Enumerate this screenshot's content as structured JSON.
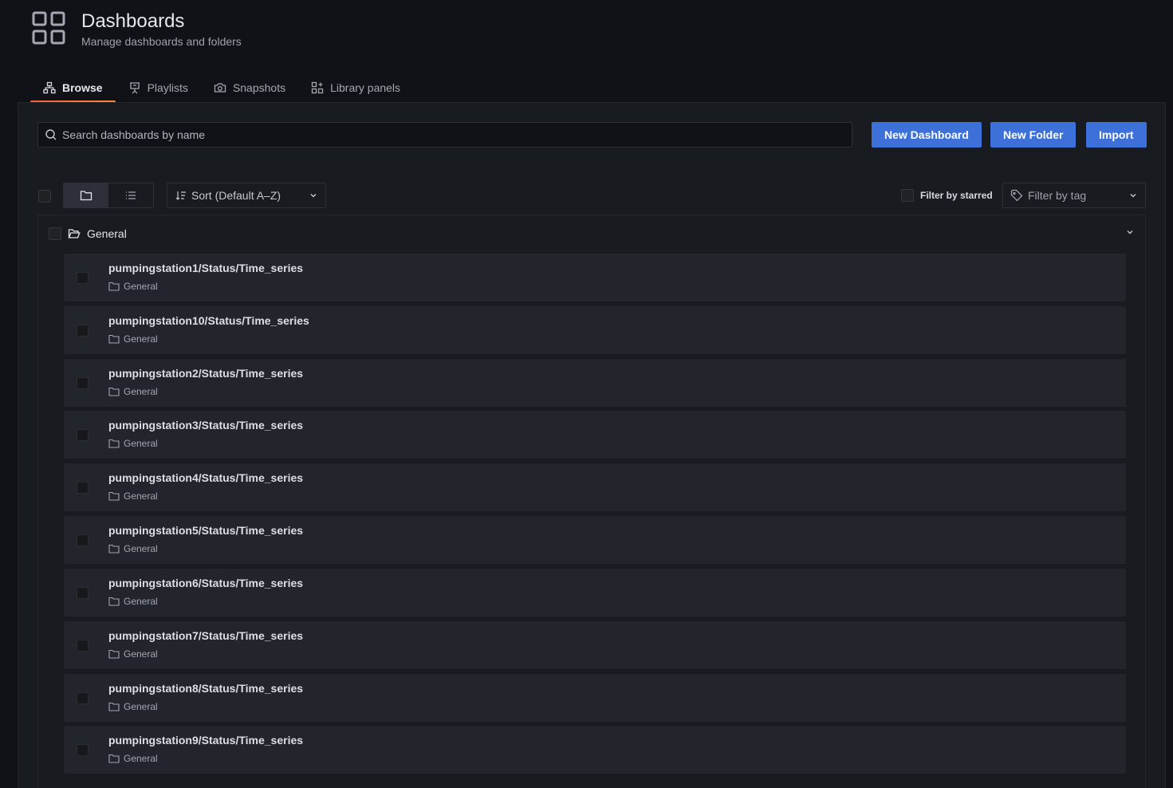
{
  "header": {
    "title": "Dashboards",
    "subtitle": "Manage dashboards and folders"
  },
  "tabs": [
    {
      "label": "Browse",
      "icon": "sitemap-icon",
      "active": true
    },
    {
      "label": "Playlists",
      "icon": "presentation-icon",
      "active": false
    },
    {
      "label": "Snapshots",
      "icon": "camera-icon",
      "active": false
    },
    {
      "label": "Library panels",
      "icon": "apps-icon",
      "active": false
    }
  ],
  "search": {
    "placeholder": "Search dashboards by name"
  },
  "actions": {
    "new_dashboard": "New Dashboard",
    "new_folder": "New Folder",
    "import": "Import"
  },
  "toolbar": {
    "sort_label": "Sort (Default A–Z)",
    "starred_label": "Filter by starred",
    "tag_placeholder": "Filter by tag"
  },
  "folder": {
    "name": "General"
  },
  "dashboards": [
    {
      "title": "pumpingstation1/Status/Time_series",
      "folder": "General"
    },
    {
      "title": "pumpingstation10/Status/Time_series",
      "folder": "General"
    },
    {
      "title": "pumpingstation2/Status/Time_series",
      "folder": "General"
    },
    {
      "title": "pumpingstation3/Status/Time_series",
      "folder": "General"
    },
    {
      "title": "pumpingstation4/Status/Time_series",
      "folder": "General"
    },
    {
      "title": "pumpingstation5/Status/Time_series",
      "folder": "General"
    },
    {
      "title": "pumpingstation6/Status/Time_series",
      "folder": "General"
    },
    {
      "title": "pumpingstation7/Status/Time_series",
      "folder": "General"
    },
    {
      "title": "pumpingstation8/Status/Time_series",
      "folder": "General"
    },
    {
      "title": "pumpingstation9/Status/Time_series",
      "folder": "General"
    }
  ],
  "colors": {
    "background": "#111217",
    "panel": "#181b1f",
    "row": "#22252b",
    "primary": "#3d71d9",
    "tab_accent": "#f55f3e"
  }
}
